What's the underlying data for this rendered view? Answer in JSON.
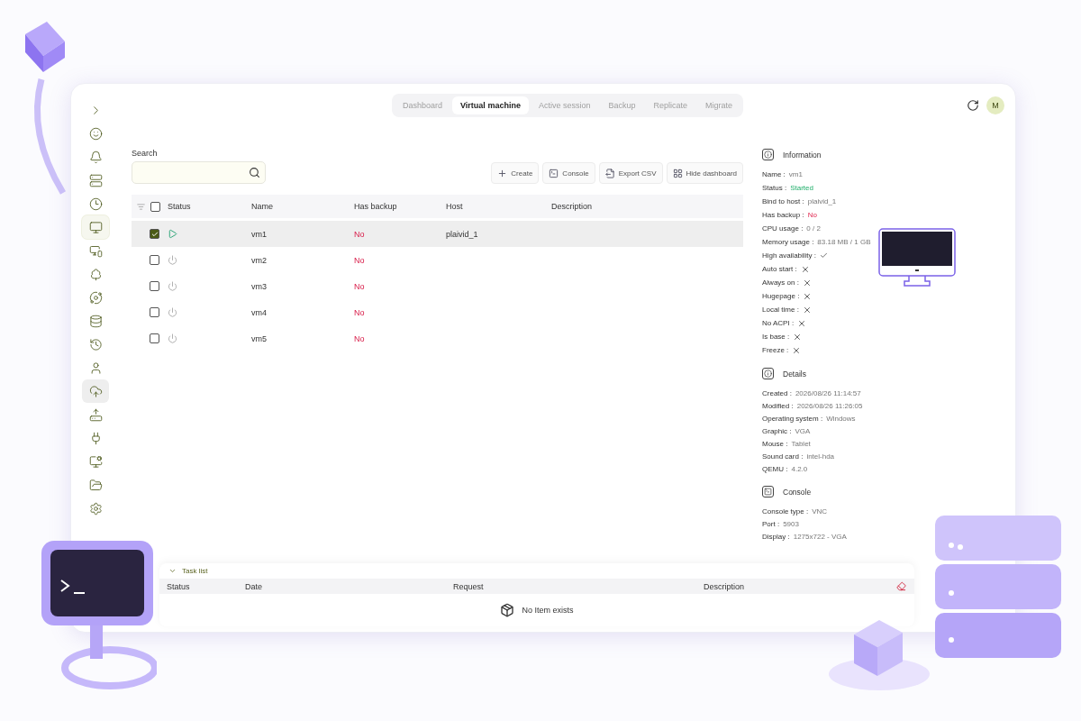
{
  "sidebar": {
    "items": [
      {
        "selected": false,
        "hovered": false
      },
      {
        "selected": false,
        "hovered": false
      },
      {
        "selected": false,
        "hovered": false
      },
      {
        "selected": false,
        "hovered": false
      },
      {
        "selected": false,
        "hovered": false
      },
      {
        "selected": true,
        "hovered": false
      },
      {
        "selected": false,
        "hovered": false
      },
      {
        "selected": false,
        "hovered": false
      },
      {
        "selected": false,
        "hovered": false
      },
      {
        "selected": false,
        "hovered": false
      },
      {
        "selected": false,
        "hovered": false
      },
      {
        "selected": false,
        "hovered": false
      },
      {
        "selected": false,
        "hovered": true
      },
      {
        "selected": false,
        "hovered": false
      },
      {
        "selected": false,
        "hovered": false
      },
      {
        "selected": false,
        "hovered": false
      },
      {
        "selected": false,
        "hovered": false
      },
      {
        "selected": false,
        "hovered": false
      }
    ]
  },
  "tabs": [
    {
      "label": "Dashboard",
      "selected": false
    },
    {
      "label": "Virtual machine",
      "selected": true
    },
    {
      "label": "Active session",
      "selected": false
    },
    {
      "label": "Backup",
      "selected": false
    },
    {
      "label": "Replicate",
      "selected": false
    },
    {
      "label": "Migrate",
      "selected": false
    }
  ],
  "user": {
    "avatar": "M"
  },
  "search": {
    "label": "Search"
  },
  "toolbar": [
    {
      "kind": "create",
      "label": "Create"
    },
    {
      "kind": "console",
      "label": "Console"
    },
    {
      "kind": "export",
      "label": "Export CSV"
    },
    {
      "kind": "dashboard",
      "label": "Hide dashboard"
    }
  ],
  "table": {
    "columns": [
      "Status",
      "Name",
      "Has backup",
      "Host",
      "Description"
    ],
    "all_checked": false,
    "rows": [
      {
        "checked": true,
        "selected": true,
        "running": true,
        "name": "vm1",
        "has_backup": "No",
        "host": "plaivid_1"
      },
      {
        "checked": false,
        "selected": false,
        "running": false,
        "name": "vm2",
        "has_backup": "No"
      },
      {
        "checked": false,
        "selected": false,
        "running": false,
        "name": "vm3",
        "has_backup": "No"
      },
      {
        "checked": false,
        "selected": false,
        "running": false,
        "name": "vm4",
        "has_backup": "No"
      },
      {
        "checked": false,
        "selected": false,
        "running": false,
        "name": "vm5",
        "has_backup": "No"
      }
    ]
  },
  "details_panel": {
    "sections": [
      {
        "kind": "info",
        "title": "Information",
        "fields": [
          {
            "label": "Name :",
            "kind": "text",
            "value": "vm1"
          },
          {
            "label": "Status :",
            "kind": "good",
            "value": "Started"
          },
          {
            "label": "Bind to host :",
            "kind": "text",
            "value": "plaivid_1"
          },
          {
            "label": "Has backup :",
            "kind": "bad",
            "value": "No"
          },
          {
            "label": "CPU usage :",
            "kind": "text",
            "value": "0 / 2"
          },
          {
            "label": "Memory usage :",
            "kind": "text",
            "value": "83.18 MB / 1 GB"
          },
          {
            "label": "High availability :",
            "kind": "flag",
            "on": true
          },
          {
            "label": "Auto start :",
            "kind": "flag",
            "on": false
          },
          {
            "label": "Always on :",
            "kind": "flag",
            "on": false
          },
          {
            "label": "Hugepage :",
            "kind": "flag",
            "on": false
          },
          {
            "label": "Local time :",
            "kind": "flag",
            "on": false
          },
          {
            "label": "No ACPI :",
            "kind": "flag",
            "on": false
          },
          {
            "label": "Is base :",
            "kind": "flag",
            "on": false
          },
          {
            "label": "Freeze :",
            "kind": "flag",
            "on": false
          }
        ]
      },
      {
        "kind": "info",
        "title": "Details",
        "fields": [
          {
            "label": "Created :",
            "kind": "text",
            "value": "2026/08/26 11:14:57"
          },
          {
            "label": "Modified :",
            "kind": "text",
            "value": "2026/08/26 11:26:05"
          },
          {
            "label": "Operating system :",
            "kind": "text",
            "value": "Windows"
          },
          {
            "label": "Graphic :",
            "kind": "text",
            "value": "VGA"
          },
          {
            "label": "Mouse :",
            "kind": "text",
            "value": "Tablet"
          },
          {
            "label": "Sound card :",
            "kind": "text",
            "value": "intel-hda"
          },
          {
            "label": "QEMU :",
            "kind": "text",
            "value": "4.2.0"
          }
        ]
      },
      {
        "kind": "console",
        "title": "Console",
        "fields": [
          {
            "label": "Console type :",
            "kind": "text",
            "value": "VNC"
          },
          {
            "label": "Port :",
            "kind": "text",
            "value": "5903"
          },
          {
            "label": "Display :",
            "kind": "text",
            "value": "1275x722 - VGA"
          }
        ]
      }
    ]
  },
  "task_list": {
    "title": "Task list",
    "expanded": true,
    "columns": [
      "Status",
      "Date",
      "Request",
      "Description"
    ],
    "empty_message": "No Item exists"
  }
}
